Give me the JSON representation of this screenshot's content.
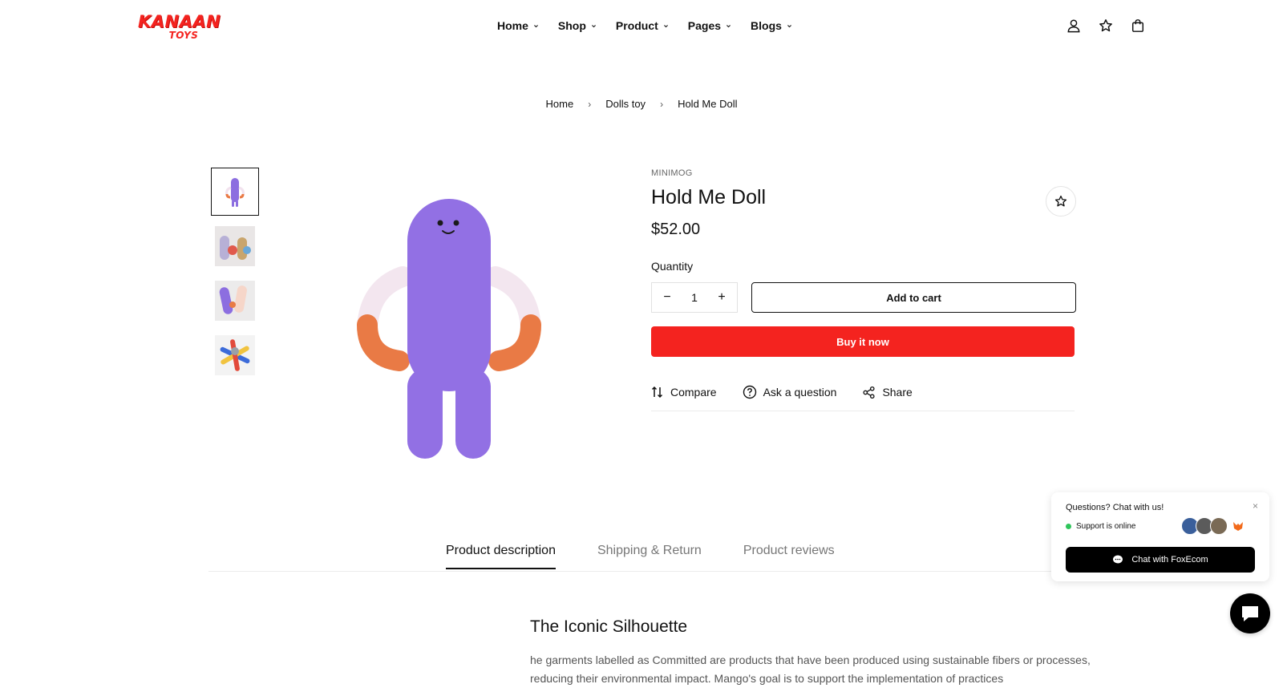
{
  "brand": {
    "logo_line1": "KANAAN",
    "logo_line2": "TOYS",
    "accent_color": "#f4231f"
  },
  "nav": {
    "items": [
      {
        "label": "Home"
      },
      {
        "label": "Shop"
      },
      {
        "label": "Product"
      },
      {
        "label": "Pages"
      },
      {
        "label": "Blogs"
      }
    ]
  },
  "header_icons": [
    "user-icon",
    "star-icon",
    "bag-icon"
  ],
  "breadcrumb": {
    "items": [
      "Home",
      "Dolls toy",
      "Hold Me Doll"
    ]
  },
  "product": {
    "vendor": "MINIMOG",
    "title": "Hold Me Doll",
    "price": "$52.00",
    "quantity_label": "Quantity",
    "quantity_value": "1",
    "add_to_cart": "Add to cart",
    "buy_now": "Buy it now",
    "actions": {
      "compare": "Compare",
      "ask": "Ask a question",
      "share": "Share"
    }
  },
  "tabs": [
    {
      "label": "Product description",
      "active": true
    },
    {
      "label": "Shipping & Return",
      "active": false
    },
    {
      "label": "Product reviews",
      "active": false
    }
  ],
  "description": {
    "heading": "The Iconic Silhouette",
    "body": "he garments labelled as Committed are products that have been produced using sustainable fibers or processes, reducing their environmental impact. Mango's goal is to support the implementation of practices"
  },
  "chat": {
    "title": "Questions? Chat with us!",
    "status": "Support is online",
    "button": "Chat with FoxEcom",
    "close": "×"
  }
}
